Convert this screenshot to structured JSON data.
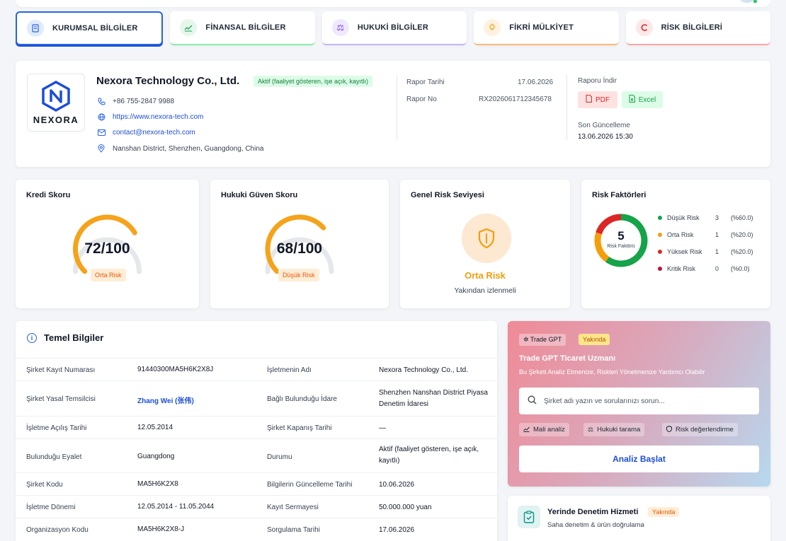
{
  "tabs": [
    {
      "label": "KURUMSAL BİLGİLER",
      "icon": "building-icon"
    },
    {
      "label": "FİNANSAL BİLGİLER",
      "icon": "chart-line-icon"
    },
    {
      "label": "HUKUKİ BİLGİLER",
      "icon": "scale-icon"
    },
    {
      "label": "FİKRİ MÜLKİYET",
      "icon": "lightbulb-icon"
    },
    {
      "label": "RİSK BİLGİLERİ",
      "icon": "risk-icon"
    }
  ],
  "company": {
    "logo_text": "NEXORA",
    "name": "Nexora Technology Co., Ltd.",
    "status": "Aktif (faaliyet gösteren, işe açık, kayıtlı)",
    "phone": "+86 755-2847 9988",
    "website": "https://www.nexora-tech.com",
    "email": "contact@nexora-tech.com",
    "address": "Nanshan District, Shenzhen, Guangdong, China"
  },
  "report": {
    "date_label": "Rapor Tarihi",
    "date_value": "17.06.2026",
    "no_label": "Rapor No",
    "no_value": "RX2026061712345678",
    "download_label": "Raporu İndir",
    "pdf_label": "PDF",
    "excel_label": "Excel",
    "updated_label": "Son Güncelleme",
    "updated_value": "13.06.2026 15:30"
  },
  "credit": {
    "title": "Kredi Skoru",
    "value": "72/100",
    "score": 72,
    "badge": "Orta Risk"
  },
  "legal": {
    "title": "Hukuki Güven Skoru",
    "value": "68/100",
    "score": 68,
    "badge": "Düşük Risk"
  },
  "general_risk": {
    "title": "Genel Risk Seviyesi",
    "level": "Orta Risk",
    "note": "Yakından izlenmeli"
  },
  "factors": {
    "title": "Risk Faktörleri",
    "total": "5",
    "total_label": "Risk Faktörü",
    "items": [
      {
        "name": "Düşük Risk",
        "count": "3",
        "pct": "(%60.0)",
        "color": "#16a34a"
      },
      {
        "name": "Orta Risk",
        "count": "1",
        "pct": "(%20.0)",
        "color": "#f59e0b"
      },
      {
        "name": "Yüksek Risk",
        "count": "1",
        "pct": "(%20.0)",
        "color": "#dc2626"
      },
      {
        "name": "Kritik Risk",
        "count": "0",
        "pct": "(%0.0)",
        "color": "#be123c"
      }
    ]
  },
  "basic": {
    "title": "Temel Bilgiler",
    "rows": [
      {
        "k1": "Şirket Kayıt Numarası",
        "v1": "91440300MA5H6K2X8J",
        "k2": "İşletmenin Adı",
        "v2": "Nexora Technology Co., Ltd."
      },
      {
        "k1": "Şirket Yasal Temsilcisi",
        "v1": "Zhang Wei (张伟)",
        "k2": "Bağlı Bulunduğu İdare",
        "v2": "Shenzhen Nanshan District Piyasa Denetim İdaresi"
      },
      {
        "k1": "İşletme Açılış Tarihi",
        "v1": "12.05.2014",
        "k2": "Şirket Kapanış Tarihi",
        "v2": "—"
      },
      {
        "k1": "Bulunduğu Eyalet",
        "v1": "Guangdong",
        "k2": "Durumu",
        "v2": "Aktif (faaliyet gösteren, işe açık, kayıtlı)"
      },
      {
        "k1": "Şirket Kodu",
        "v1": "MA5H6K2X8",
        "k2": "Bilgilerin Güncelleme Tarihi",
        "v2": "10.06.2026"
      },
      {
        "k1": "İşletme Dönemi",
        "v1": "12.05.2014 - 11.05.2044",
        "k2": "Kayıt Sermayesi",
        "v2": "50.000.000 yuan"
      },
      {
        "k1": "Organizasyon Kodu",
        "v1": "MA5H6K2X8-J",
        "k2": "Sorgulama Tarihi",
        "v2": "17.06.2026"
      }
    ]
  },
  "gpt": {
    "chip": "Trade GPT",
    "soon": "Yakında",
    "title": "Trade GPT Ticaret Uzmanı",
    "subtitle": "Bu Şirketi Analiz Etmenize, Riskleri Yönetmenize Yardımcı Olabilir",
    "placeholder": "Şirket adı yazın ve sorularınızı sorun...",
    "pills": [
      "Mali analiz",
      "Hukuki tarama",
      "Risk değerlendirme"
    ],
    "button": "Analiz Başlat"
  },
  "inspection": {
    "title": "Yerinde Denetim Hizmeti",
    "soon": "Yakında",
    "subtitle": "Saha denetim & ürün doğrulama"
  }
}
